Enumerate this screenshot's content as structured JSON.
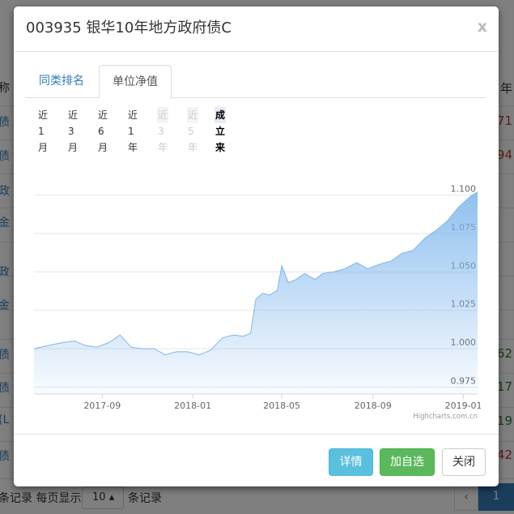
{
  "background": {
    "left_fragments": [
      {
        "text": "称",
        "color": "#333333"
      },
      {
        "text": "债",
        "color": "#337ab7"
      },
      {
        "text": "债",
        "color": "#337ab7"
      },
      {
        "text": "政",
        "color": "#337ab7"
      },
      {
        "text": "金",
        "color": "#337ab7"
      },
      {
        "text": "政",
        "color": "#337ab7"
      },
      {
        "text": "金",
        "color": "#337ab7"
      },
      {
        "text": "债",
        "color": "#337ab7"
      },
      {
        "text": "债",
        "color": "#337ab7"
      },
      {
        "text": "(L",
        "color": "#337ab7"
      },
      {
        "text": "债",
        "color": "#337ab7"
      }
    ],
    "right_fragments": [
      {
        "text": "年",
        "color": "#333333"
      },
      {
        "text": "71",
        "color": "#c9302c"
      },
      {
        "text": "94",
        "color": "#c9302c"
      },
      {
        "text": "62",
        "color": "#2e7d32"
      },
      {
        "text": "17",
        "color": "#2e7d32"
      },
      {
        "text": "19",
        "color": "#2e7d32"
      },
      {
        "text": "42",
        "color": "#c9302c"
      }
    ],
    "footer": {
      "records_label": "条记录 每页显示",
      "page_size": "10",
      "records_suffix": "条记录",
      "prev": "‹",
      "page": "1"
    }
  },
  "modal": {
    "title": "003935 银华10年地方政府债C",
    "close_symbol": "x",
    "tabs": [
      "同类排名",
      "单位净值"
    ],
    "active_tab": 1,
    "ranges": [
      {
        "label": "近1月",
        "state": "normal"
      },
      {
        "label": "近3月",
        "state": "normal"
      },
      {
        "label": "近6月",
        "state": "normal"
      },
      {
        "label": "近1年",
        "state": "normal"
      },
      {
        "label": "近3年",
        "state": "disabled"
      },
      {
        "label": "近5年",
        "state": "disabled"
      },
      {
        "label": "成立来",
        "state": "active"
      }
    ],
    "buttons": {
      "detail": "详情",
      "add": "加自选",
      "close": "关闭"
    },
    "credits": "Highcharts.com.cn"
  },
  "chart_data": {
    "type": "area",
    "title": "",
    "xlabel": "",
    "ylabel": "",
    "x_ticks": [
      "2017-09",
      "2018-01",
      "2018-05",
      "2018-09",
      "2019-01"
    ],
    "y_ticks": [
      0.975,
      1.0,
      1.025,
      1.05,
      1.075,
      1.1
    ],
    "ylim": [
      0.9705,
      1.1225
    ],
    "xlim": [
      "2017-06-01",
      "2019-01-20"
    ],
    "grid": true,
    "series": [
      {
        "name": "",
        "color": "#7cb5ec",
        "x": [
          "2017-06-01",
          "2017-06-20",
          "2017-07-10",
          "2017-07-25",
          "2017-08-10",
          "2017-08-25",
          "2017-09-10",
          "2017-09-25",
          "2017-10-10",
          "2017-10-25",
          "2017-11-10",
          "2017-11-25",
          "2017-12-10",
          "2017-12-25",
          "2018-01-10",
          "2018-01-25",
          "2018-02-10",
          "2018-02-25",
          "2018-03-10",
          "2018-03-20",
          "2018-03-27",
          "2018-04-05",
          "2018-04-15",
          "2018-04-25",
          "2018-05-01",
          "2018-05-10",
          "2018-05-20",
          "2018-06-01",
          "2018-06-15",
          "2018-06-25",
          "2018-07-10",
          "2018-07-25",
          "2018-08-10",
          "2018-08-25",
          "2018-09-10",
          "2018-09-25",
          "2018-10-10",
          "2018-10-25",
          "2018-11-10",
          "2018-11-25",
          "2018-12-10",
          "2018-12-25",
          "2019-01-10",
          "2019-01-20"
        ],
        "y": [
          1.0,
          1.002,
          1.004,
          1.005,
          1.002,
          1.001,
          1.004,
          1.009,
          1.001,
          1.0,
          1.0,
          0.996,
          0.998,
          0.998,
          0.996,
          0.999,
          1.007,
          1.009,
          1.008,
          1.01,
          1.032,
          1.036,
          1.035,
          1.038,
          1.054,
          1.043,
          1.045,
          1.049,
          1.045,
          1.049,
          1.05,
          1.052,
          1.056,
          1.052,
          1.055,
          1.057,
          1.062,
          1.064,
          1.072,
          1.077,
          1.083,
          1.092,
          1.099,
          1.102
        ]
      }
    ]
  }
}
